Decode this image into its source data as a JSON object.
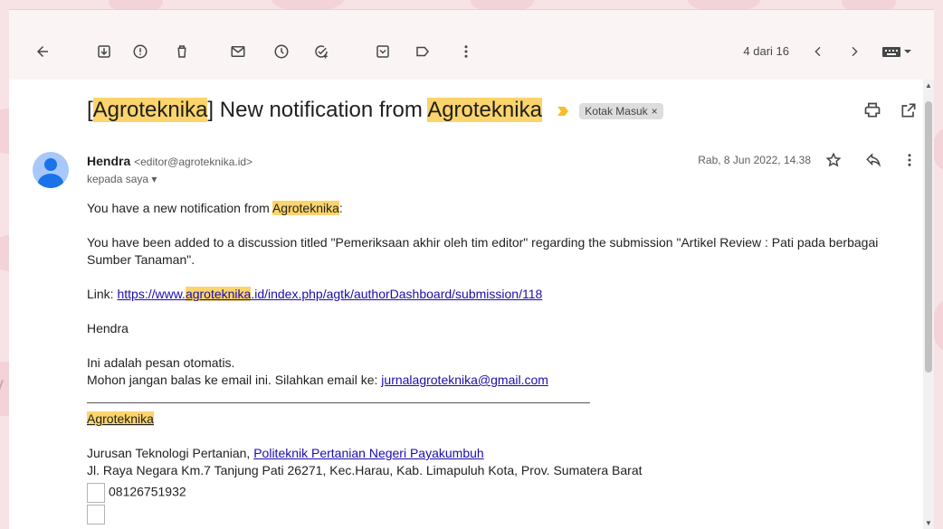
{
  "toolbar": {
    "pager_text": "4 dari 16",
    "icons": [
      "back-arrow-icon",
      "archive-icon",
      "report-spam-icon",
      "delete-icon",
      "mark-unread-icon",
      "snooze-icon",
      "add-task-icon",
      "move-to-icon",
      "label-icon",
      "more-vert-icon",
      "prev-chevron-icon",
      "next-chevron-icon",
      "keyboard-icon"
    ]
  },
  "email": {
    "subject_prefix": "[",
    "subject_hl1": "Agroteknika",
    "subject_mid": "] New notification from ",
    "subject_hl2": "Agroteknika",
    "label_chip": "Kotak Masuk",
    "label_close": "×",
    "sender_name": "Hendra",
    "sender_email": "<editor@agroteknika.id>",
    "to_line": "kepada saya ▾",
    "date": "Rab, 8 Jun 2022, 14.38",
    "body": {
      "line1_prefix": "You have a new notification from ",
      "line1_hl": "Agroteknika",
      "line1_suffix": ":",
      "line2": "You have been added to a discussion titled \"Pemeriksaan akhir oleh tim editor\" regarding the submission \"Artikel Review : Pati pada berbagai Sumber Tanaman\".",
      "link_label": "Link: ",
      "link_pre": "https://www.",
      "link_hl": "agroteknika",
      "link_post": ".id/index.php/agtk/authorDashboard/submission/118",
      "sign_name": "Hendra",
      "auto1": "Ini adalah pesan otomatis.",
      "auto2_prefix": "Mohon jangan balas ke email ini. Silahkan email ke: ",
      "auto2_link": "jurnalagroteknika@gmail.com",
      "sig_title": "Agroteknika",
      "sig_dept": "Jurusan Teknologi Pertanian, ",
      "sig_dept_link": "Politeknik Pertanian Negeri Payakumbuh",
      "sig_address": "Jl. Raya Negara Km.7 Tanjung Pati 26271, Kec.Harau, Kab. Limapuluh Kota, Prov. Sumatera Barat",
      "sig_phone": "08126751932"
    }
  },
  "colors": {
    "highlight": "#fbd46b",
    "link": "#1a0dab",
    "importance": "#f6bf26",
    "avatar": "#1a73e8"
  }
}
